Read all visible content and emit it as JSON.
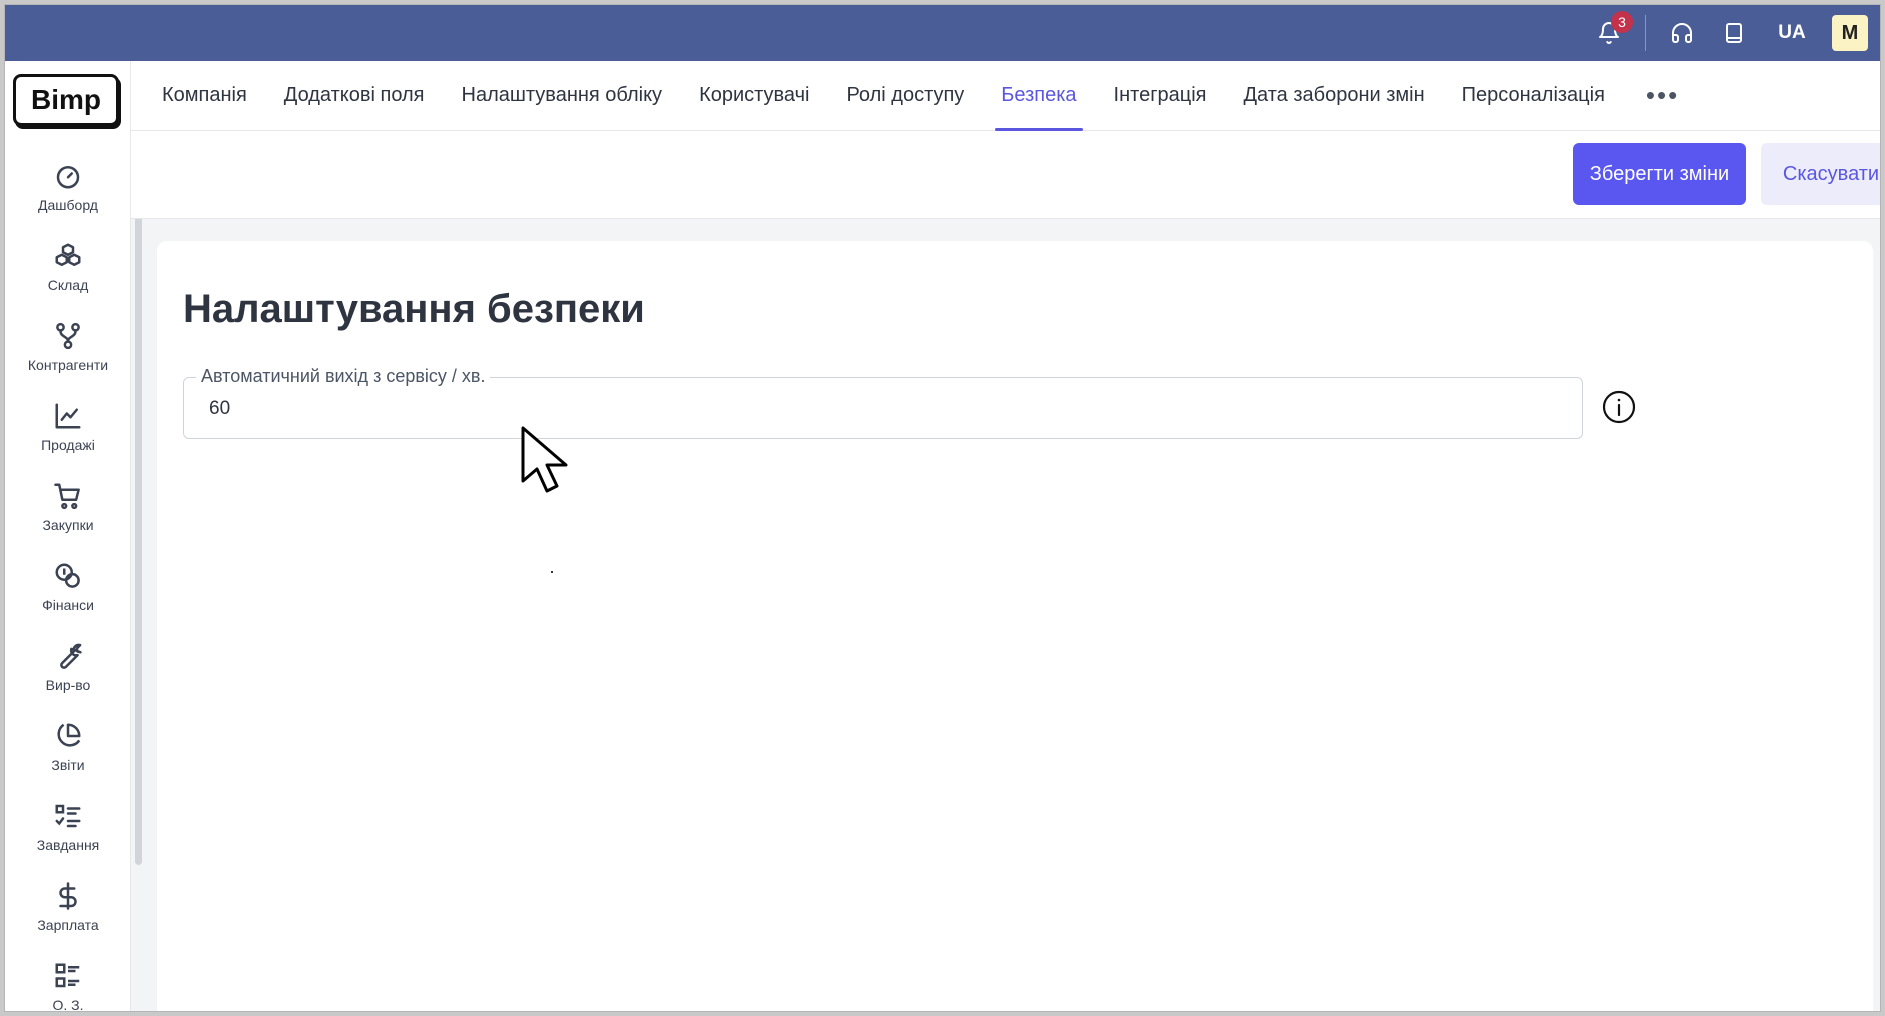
{
  "topbar": {
    "notifications_count": "3",
    "language": "UA",
    "avatar_letter": "M"
  },
  "sidebar": {
    "logo": "Bimp",
    "items": [
      {
        "label": "Дашборд",
        "icon": "speedometer-icon"
      },
      {
        "label": "Склад",
        "icon": "boxes-icon"
      },
      {
        "label": "Контрагенти",
        "icon": "network-icon"
      },
      {
        "label": "Продажі",
        "icon": "line-chart-icon"
      },
      {
        "label": "Закупки",
        "icon": "cart-icon"
      },
      {
        "label": "Фінанси",
        "icon": "coins-icon"
      },
      {
        "label": "Вир-во",
        "icon": "wrench-icon"
      },
      {
        "label": "Звіти",
        "icon": "pie-chart-icon"
      },
      {
        "label": "Завдання",
        "icon": "checklist-icon"
      },
      {
        "label": "Зарплата",
        "icon": "dollar-icon"
      },
      {
        "label": "О. З.",
        "icon": "list-grid-icon"
      }
    ]
  },
  "tabs": [
    {
      "label": "Компанія",
      "active": false
    },
    {
      "label": "Додаткові поля",
      "active": false
    },
    {
      "label": "Налаштування обліку",
      "active": false
    },
    {
      "label": "Користувачі",
      "active": false
    },
    {
      "label": "Ролі доступу",
      "active": false
    },
    {
      "label": "Безпека",
      "active": true
    },
    {
      "label": "Інтеграція",
      "active": false
    },
    {
      "label": "Дата заборони змін",
      "active": false
    },
    {
      "label": "Персоналізація",
      "active": false
    }
  ],
  "tabs_more": "•••",
  "actions": {
    "save_label": "Зберегти зміни",
    "cancel_label": "Скасувати"
  },
  "content": {
    "title": "Налаштування безпеки",
    "field_label": "Автоматичний вихід з сервісу / хв.",
    "field_value": "60"
  },
  "colors": {
    "topbar": "#4a5d96",
    "accent": "#5a56f0",
    "badge": "#c4314b"
  }
}
